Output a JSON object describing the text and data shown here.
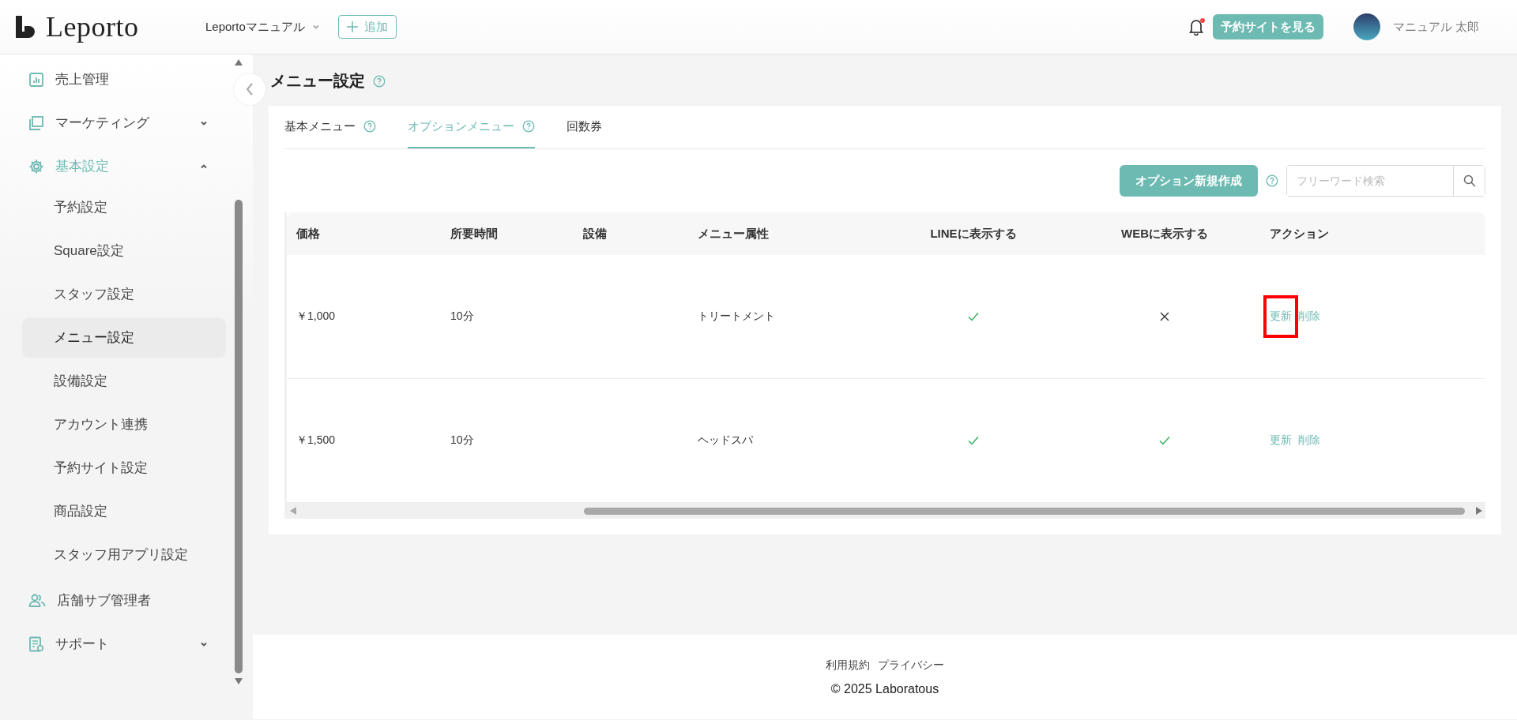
{
  "header": {
    "logo": "Leporto",
    "store_selector": "Leportoマニュアル",
    "add_button": "追加",
    "notifications": {
      "unread": true
    },
    "site_button": "予約サイトを見る",
    "user_name": "マニュアル 太郎"
  },
  "sidebar": {
    "items": [
      {
        "label": "売上管理",
        "active": false
      },
      {
        "label": "マーケティング",
        "active": false,
        "expanded": false
      },
      {
        "label": "基本設定",
        "active": true,
        "expanded": true,
        "children": [
          {
            "label": "予約設定",
            "selected": false
          },
          {
            "label": "Square設定",
            "selected": false
          },
          {
            "label": "スタッフ設定",
            "selected": false
          },
          {
            "label": "メニュー設定",
            "selected": true
          },
          {
            "label": "設備設定",
            "selected": false
          },
          {
            "label": "アカウント連携",
            "selected": false
          },
          {
            "label": "予約サイト設定",
            "selected": false
          },
          {
            "label": "商品設定",
            "selected": false
          },
          {
            "label": "スタッフ用アプリ設定",
            "selected": false
          }
        ]
      },
      {
        "label": "店舗サブ管理者",
        "active": false
      },
      {
        "label": "サポート",
        "active": false,
        "expanded": false
      }
    ]
  },
  "page": {
    "title": "メニュー設定",
    "tabs": [
      {
        "label": "基本メニュー",
        "selected": false,
        "help": true
      },
      {
        "label": "オプションメニュー",
        "selected": true,
        "help": true
      },
      {
        "label": "回数券",
        "selected": false,
        "help": false
      }
    ],
    "create_button": "オプション新規作成",
    "search": {
      "placeholder": "フリーワード検索"
    },
    "table": {
      "columns": [
        "価格",
        "所要時間",
        "設備",
        "メニュー属性",
        "LINEに表示する",
        "WEBに表示する",
        "アクション"
      ],
      "rows": [
        {
          "price": "￥1,000",
          "duration": "10分",
          "attribute": "トリートメント",
          "show_on_line": true,
          "show_on_web": false,
          "actions": [
            {
              "label": "更新",
              "highlighted": true
            },
            {
              "label": "削除",
              "highlighted": false
            }
          ]
        },
        {
          "price": "￥1,500",
          "duration": "10分",
          "attribute": "ヘッドスパ",
          "show_on_line": true,
          "show_on_web": true,
          "actions": [
            {
              "label": "更新",
              "highlighted": false
            },
            {
              "label": "削除",
              "highlighted": false
            }
          ]
        }
      ]
    }
  },
  "footer": {
    "links": [
      "利用規約",
      "プライバシー"
    ],
    "copyright": "© 2025 Laboratous"
  }
}
